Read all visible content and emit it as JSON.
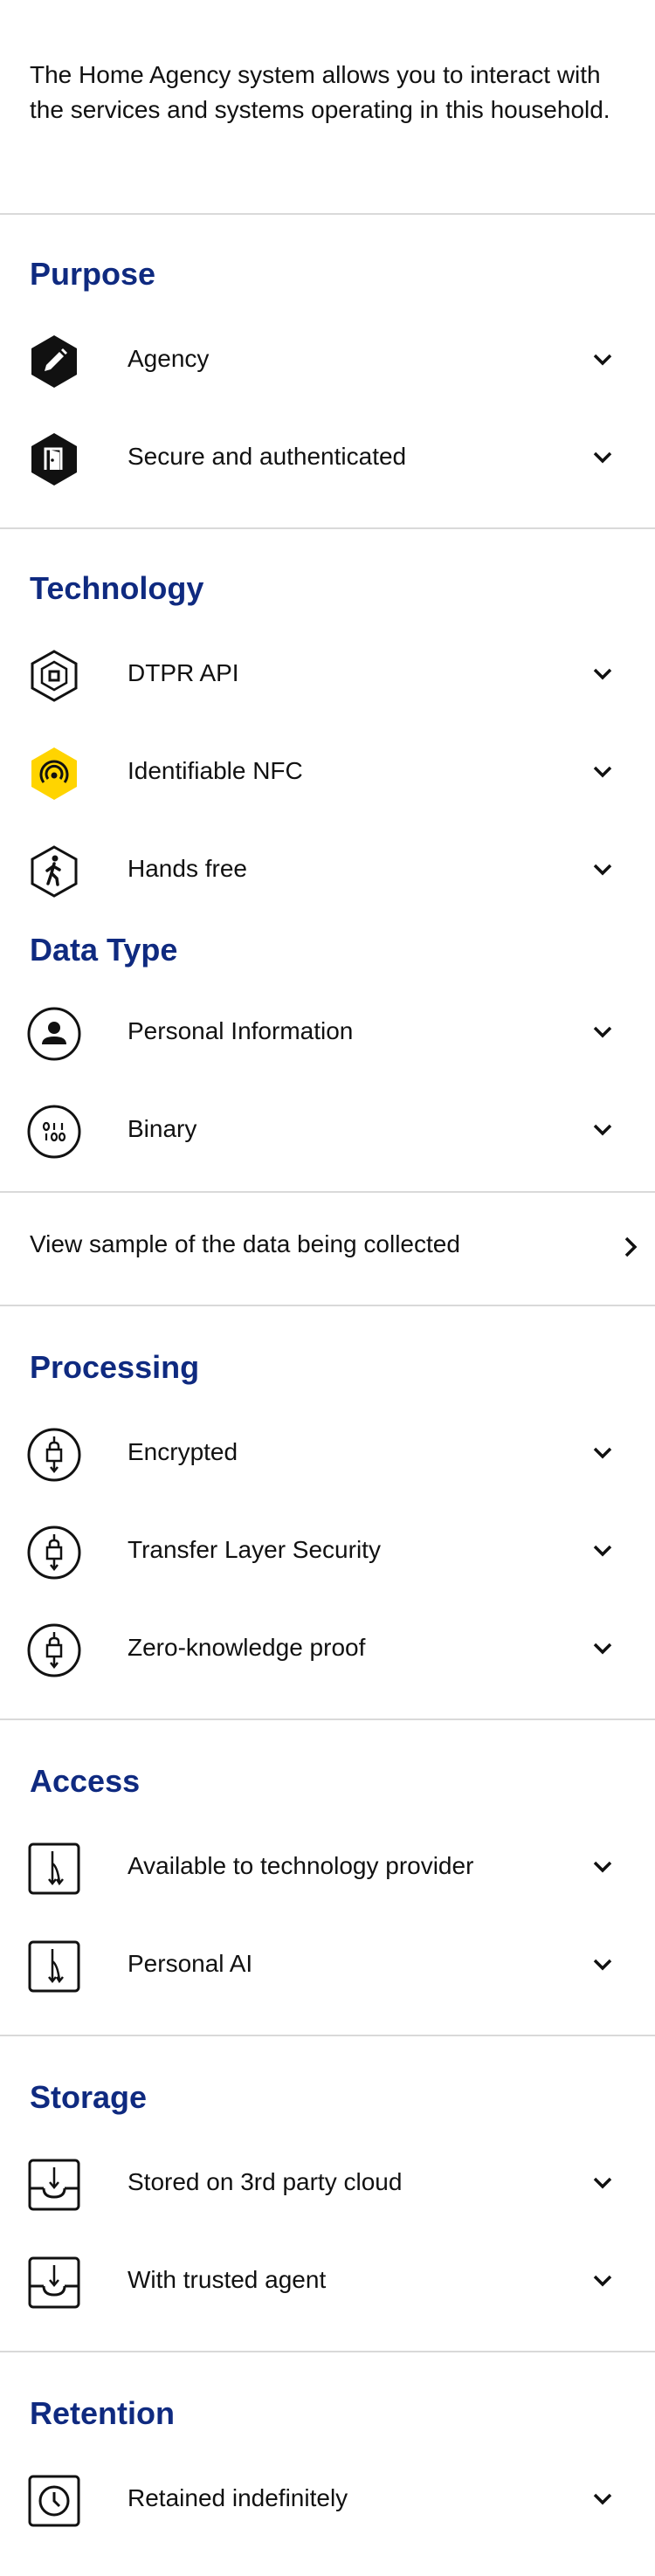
{
  "intro": "The Home Agency system allows you to interact with the services and systems operating in this household.",
  "colors": {
    "heading": "#0f2a80",
    "divider": "#d9d9d9",
    "nfc_badge": "#ffd400",
    "icon": "#111111"
  },
  "sections": {
    "purpose": {
      "title": "Purpose",
      "items": [
        {
          "label": "Agency",
          "icon": "pencil-hexagon-icon"
        },
        {
          "label": "Secure and authenticated",
          "icon": "door-hexagon-icon"
        }
      ]
    },
    "technology": {
      "title": "Technology",
      "items": [
        {
          "label": "DTPR API",
          "icon": "api-hexagon-icon"
        },
        {
          "label": "Identifiable NFC",
          "icon": "nfc-hexagon-icon"
        },
        {
          "label": "Hands free",
          "icon": "walking-person-hexagon-icon"
        }
      ]
    },
    "data_type": {
      "title": "Data Type",
      "items": [
        {
          "label": "Personal Information",
          "icon": "person-circle-icon"
        },
        {
          "label": "Binary",
          "icon": "binary-circle-icon"
        }
      ],
      "sample_link": "View sample of the data being collected"
    },
    "processing": {
      "title": "Processing",
      "items": [
        {
          "label": "Encrypted",
          "icon": "lock-circle-icon"
        },
        {
          "label": "Transfer Layer Security",
          "icon": "lock-circle-icon"
        },
        {
          "label": "Zero-knowledge proof",
          "icon": "lock-circle-icon"
        }
      ]
    },
    "access": {
      "title": "Access",
      "items": [
        {
          "label": "Available to technology provider",
          "icon": "fork-arrow-square-icon"
        },
        {
          "label": "Personal AI",
          "icon": "fork-arrow-square-icon"
        }
      ]
    },
    "storage": {
      "title": "Storage",
      "items": [
        {
          "label": "Stored on 3rd party cloud",
          "icon": "inbox-download-icon"
        },
        {
          "label": "With trusted agent",
          "icon": "inbox-download-icon"
        }
      ]
    },
    "retention": {
      "title": "Retention",
      "items": [
        {
          "label": "Retained indefinitely",
          "icon": "clock-square-icon"
        }
      ]
    }
  }
}
